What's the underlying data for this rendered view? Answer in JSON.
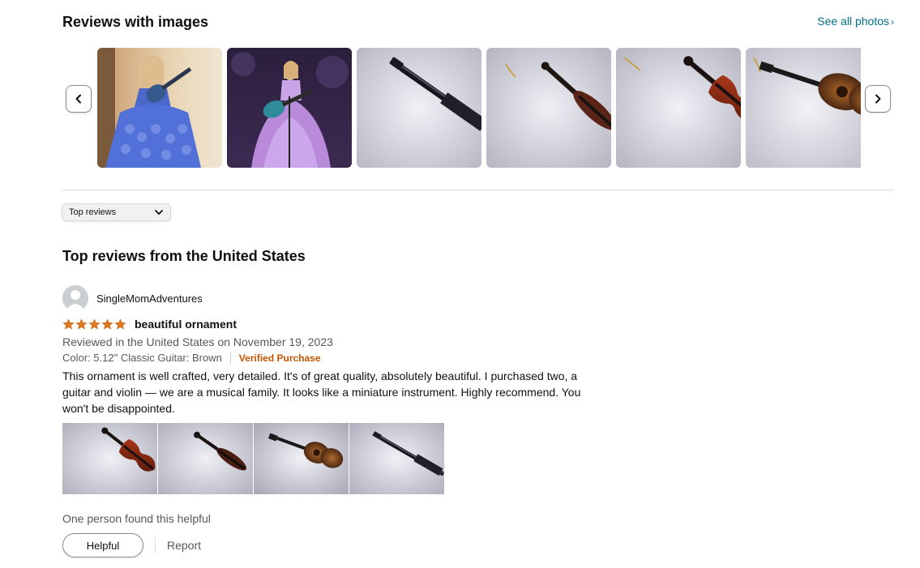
{
  "images_section": {
    "title": "Reviews with images",
    "see_all_label": "See all photos",
    "thumbnails": [
      {
        "subject": "doll-with-guitar-photo"
      },
      {
        "subject": "performer-with-guitar-photo"
      },
      {
        "subject": "guitar-neck-ornament-photo"
      },
      {
        "subject": "violin-side-ornament-photo"
      },
      {
        "subject": "violin-ornament-photo"
      },
      {
        "subject": "guitar-ornament-photo"
      }
    ],
    "prev_icon": "chevron-left-icon",
    "next_icon": "chevron-right-icon"
  },
  "sort": {
    "selected": "Top reviews",
    "icon": "chevron-down-icon"
  },
  "reviews_section": {
    "title": "Top reviews from the United States"
  },
  "review": {
    "author": "SingleMomAdventures",
    "rating": 5,
    "rating_max": 5,
    "title": "beautiful ornament",
    "date_line": "Reviewed in the United States on November 19, 2023",
    "variant": "Color: 5.12\" Classic Guitar: Brown",
    "verified": "Verified Purchase",
    "body": "This ornament is well crafted, very detailed. It's of great quality, absolutely beautiful. I purchased two, a guitar and violin — we are a musical family. It looks like a miniature instrument. Highly recommend. You won't be disappointed.",
    "images": [
      {
        "subject": "violin-photo"
      },
      {
        "subject": "violin-side-photo"
      },
      {
        "subject": "guitar-photo"
      },
      {
        "subject": "guitar-neck-photo"
      }
    ],
    "helpful_count_text": "One person found this helpful",
    "helpful_label": "Helpful",
    "report_label": "Report"
  },
  "colors": {
    "link": "#007185",
    "star": "#de7921",
    "verified": "#c45500",
    "muted_text": "#565959"
  }
}
